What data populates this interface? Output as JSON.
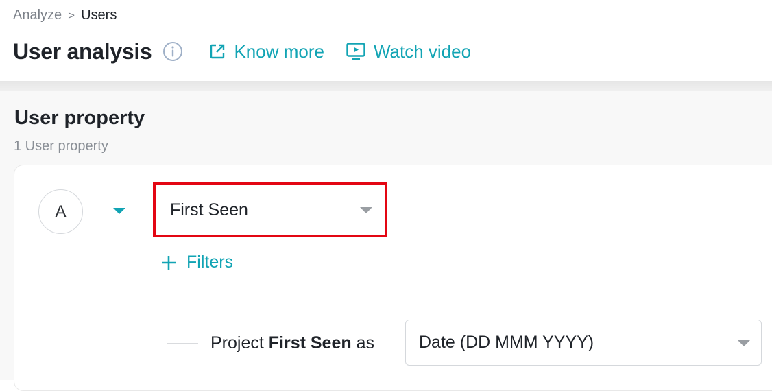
{
  "breadcrumb": {
    "parent": "Analyze",
    "separator": ">",
    "current": "Users"
  },
  "header": {
    "title": "User analysis",
    "know_more_label": "Know more",
    "watch_video_label": "Watch video",
    "accent_color": "#12a4b4"
  },
  "section": {
    "title": "User property",
    "subtitle": "1 User property"
  },
  "property": {
    "badge": "A",
    "selected": "First Seen",
    "filters_label": "Filters",
    "project_prefix": "Project",
    "project_property": "First Seen",
    "project_suffix": "as",
    "format_selected": "Date (DD MMM YYYY)",
    "highlight_color": "#e30613"
  },
  "icons": {
    "info": "info-circle-icon",
    "know_more": "external-link-icon",
    "watch_video": "video-play-icon",
    "add_filter": "plus-icon",
    "collapse": "caret-down-icon",
    "select_arrow": "chevron-down-icon"
  }
}
